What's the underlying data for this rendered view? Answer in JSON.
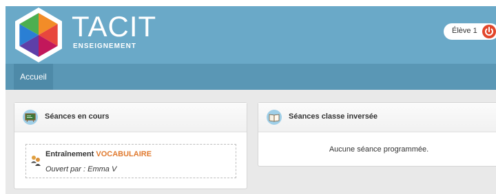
{
  "brand": {
    "name": "TACIT",
    "tagline": "ENSEIGNEMENT"
  },
  "user": {
    "label": "Élève 1",
    "power_icon": "power-icon"
  },
  "nav": {
    "tabs": [
      {
        "label": "Accueil",
        "active": true
      }
    ]
  },
  "panels": {
    "current": {
      "title": "Séances en cours",
      "icon": "chalkboard-icon",
      "session": {
        "title_prefix": "Entraînement",
        "title_accent": "VOCABULAIRE",
        "opened_by": "Ouvert par : Emma V",
        "icon": "users-icon"
      }
    },
    "flipped": {
      "title": "Séances classe inversée",
      "icon": "book-icon",
      "empty_message": "Aucune séance programmée."
    }
  },
  "colors": {
    "header": "#6aa9c8",
    "navbar": "#5a97b5",
    "accent": "#e07a2f",
    "power": "#e2462b"
  }
}
